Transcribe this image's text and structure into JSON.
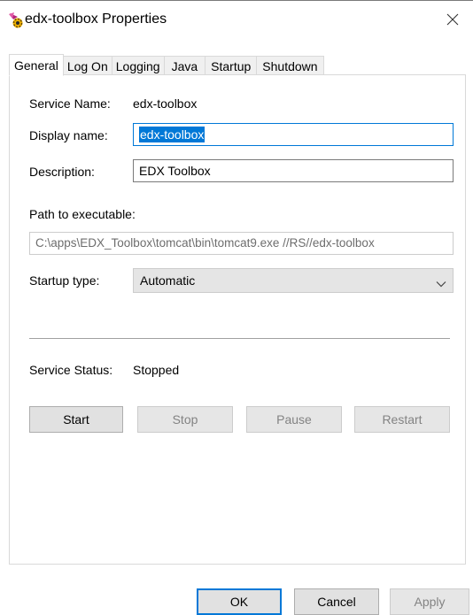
{
  "window": {
    "title": "edx-toolbox Properties",
    "app_icon": "service-gear-icon",
    "close_icon": "close-icon"
  },
  "tabs": [
    "General",
    "Log On",
    "Logging",
    "Java",
    "Startup",
    "Shutdown"
  ],
  "general": {
    "service_name_label": "Service Name:",
    "service_name_value": "edx-toolbox",
    "display_name_label": "Display name:",
    "display_name_value": "edx-toolbox",
    "description_label": "Description:",
    "description_value": "EDX Toolbox",
    "path_label": "Path to executable:",
    "path_value": "C:\\apps\\EDX_Toolbox\\tomcat\\bin\\tomcat9.exe //RS//edx-toolbox",
    "startup_type_label": "Startup type:",
    "startup_type_value": "Automatic",
    "service_status_label": "Service Status:",
    "service_status_value": "Stopped",
    "buttons": {
      "start": "Start",
      "stop": "Stop",
      "pause": "Pause",
      "restart": "Restart"
    }
  },
  "footer": {
    "ok": "OK",
    "cancel": "Cancel",
    "apply": "Apply"
  },
  "colors": {
    "accent": "#0078d7",
    "button_bg": "#e1e1e1",
    "disabled_text": "#838383"
  }
}
